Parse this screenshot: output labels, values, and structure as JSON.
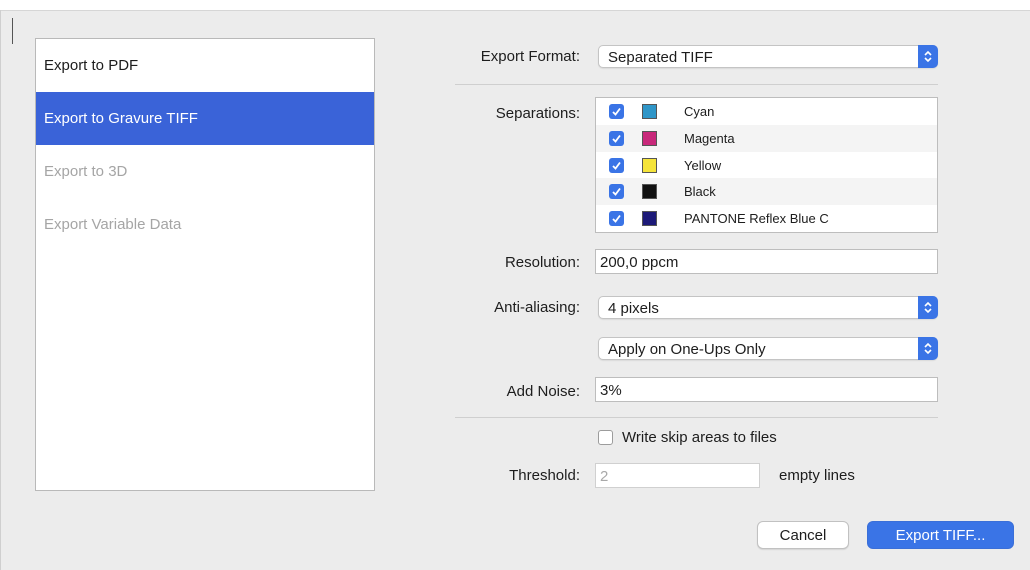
{
  "sidebar": {
    "items": [
      {
        "label": "Export to PDF"
      },
      {
        "label": "Export to Gravure TIFF"
      },
      {
        "label": "Export to 3D"
      },
      {
        "label": "Export Variable Data"
      }
    ]
  },
  "form": {
    "export_format": {
      "label": "Export Format:",
      "value": "Separated TIFF"
    },
    "separations": {
      "label": "Separations:",
      "items": [
        {
          "name": "Cyan",
          "color": "#2f96c8",
          "checked": true
        },
        {
          "name": "Magenta",
          "color": "#c8287a",
          "checked": true
        },
        {
          "name": "Yellow",
          "color": "#f5e43a",
          "checked": true
        },
        {
          "name": "Black",
          "color": "#111111",
          "checked": true
        },
        {
          "name": "PANTONE Reflex Blue C",
          "color": "#1d1a78",
          "checked": true
        }
      ]
    },
    "resolution": {
      "label": "Resolution:",
      "value": "200,0 ppcm"
    },
    "anti_aliasing": {
      "label": "Anti-aliasing:",
      "value": "4 pixels"
    },
    "apply_mode": {
      "value": "Apply on One-Ups Only"
    },
    "add_noise": {
      "label": "Add Noise:",
      "value": "3%"
    },
    "write_skip": {
      "label": "Write skip areas to files",
      "checked": false
    },
    "threshold": {
      "label": "Threshold:",
      "value": "2",
      "suffix": "empty lines"
    }
  },
  "buttons": {
    "cancel": "Cancel",
    "export": "Export TIFF..."
  },
  "colors": {
    "accent": "#3a74e6",
    "selection": "#3a63d8"
  }
}
